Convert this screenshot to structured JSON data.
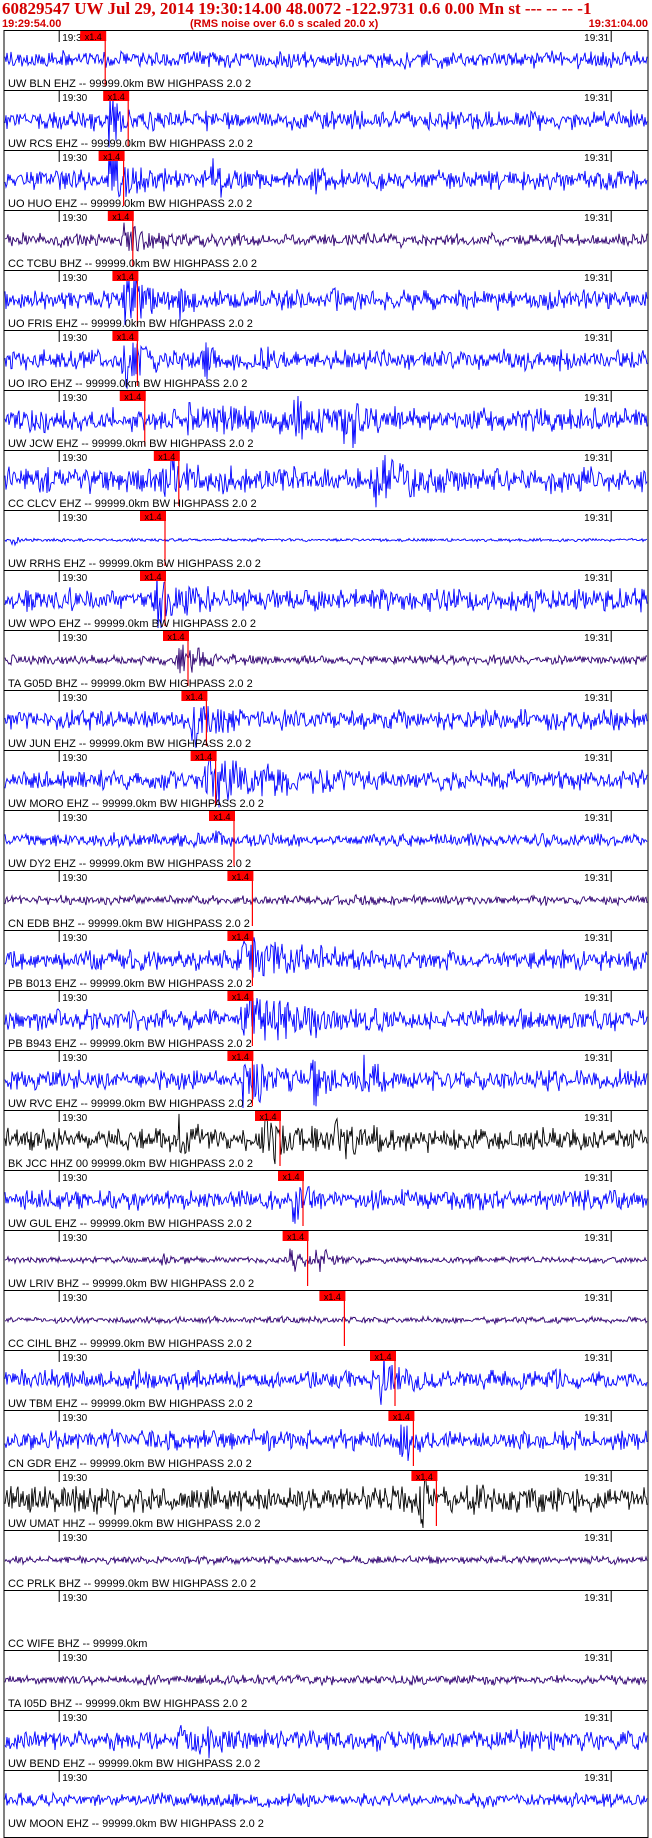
{
  "header": {
    "title": "60829547 UW Jul 29, 2014 19:30:14.00   48.0072 -122.9731  0.6 0.00 Mn st --- -- --   -1",
    "start_time": "19:29:54.00",
    "note": "(RMS noise over 6.0 s scaled 20.0 x)",
    "end_time": "19:31:04.00"
  },
  "chart_data": {
    "type": "line",
    "title": "60829547 UW Jul 29, 2014 19:30:14.00   48.0072 -122.9731  0.6 0.00 Mn st --- -- --   -1",
    "x_range": [
      "19:29:54.00",
      "19:31:04.00"
    ],
    "minute_tick_labels": [
      "19:30",
      "19:31"
    ],
    "pick_label": "x1.4",
    "pick_color": "#ff0000",
    "rows": [
      {
        "label": "UW BLN EHZ -- 99999.0km BW  HIGHPASS  2.0  2",
        "color": "#0000ff",
        "pick_s": 8.5,
        "amp": 0.25,
        "events": []
      },
      {
        "label": "UW RCS EHZ -- 99999.0km BW  HIGHPASS  2.0  2",
        "color": "#0000ff",
        "pick_s": 11.0,
        "amp": 0.3,
        "events": [
          [
            11.5,
            0.9,
            1.5
          ]
        ]
      },
      {
        "label": "UO HUO EHZ -- 99999.0km BW  HIGHPASS  2.0  2",
        "color": "#0000ff",
        "pick_s": 10.5,
        "amp": 0.3,
        "events": [
          [
            11.5,
            1.0,
            3
          ],
          [
            22.5,
            0.8,
            1.5
          ],
          [
            34,
            0.6,
            0.8
          ]
        ]
      },
      {
        "label": "CC TCBU BHZ -- 99999.0km BW  HIGHPASS  2.0  2",
        "color": "#2e0070",
        "pick_s": 11.5,
        "amp": 0.2,
        "events": [
          [
            13,
            0.6,
            4
          ]
        ]
      },
      {
        "label": "UO FRIS EHZ -- 99999.0km BW  HIGHPASS  2.0  2",
        "color": "#0000ff",
        "pick_s": 12.0,
        "amp": 0.3,
        "events": [
          [
            13,
            1.0,
            3
          ],
          [
            19,
            0.7,
            1
          ],
          [
            35.5,
            0.9,
            0.8
          ]
        ]
      },
      {
        "label": "UO IRO EHZ -- 99999.0km BW  HIGHPASS  2.0  2",
        "color": "#0000ff",
        "pick_s": 12.0,
        "amp": 0.3,
        "events": [
          [
            13,
            1.0,
            3
          ],
          [
            22,
            0.8,
            1.5
          ],
          [
            28,
            0.5,
            0.6
          ]
        ]
      },
      {
        "label": "UW JCW EHZ -- 99999.0km BW  HIGHPASS  2.0  2",
        "color": "#0000ff",
        "pick_s": 12.8,
        "amp": 0.35,
        "events": [
          [
            20,
            0.5,
            8
          ],
          [
            31.5,
            0.8,
            2
          ],
          [
            37,
            0.9,
            3
          ]
        ]
      },
      {
        "label": "CC CLCV EHZ -- 99999.0km BW  HIGHPASS  2.0  2",
        "color": "#0000ff",
        "pick_s": 16.5,
        "amp": 0.4,
        "events": [
          [
            17.5,
            0.8,
            3
          ],
          [
            40,
            1.0,
            4
          ]
        ]
      },
      {
        "label": "UW RRHS EHZ -- 99999.0km BW  HIGHPASS  2.0  2",
        "color": "#0000ff",
        "pick_s": 15.0,
        "amp": 0.05,
        "events": [
          [
            1,
            0.4,
            0.5
          ]
        ]
      },
      {
        "label": "UW WPO EHZ -- 99999.0km BW  HIGHPASS  2.0  2",
        "color": "#0000ff",
        "pick_s": 15.0,
        "amp": 0.35,
        "events": [
          [
            16.5,
            1.0,
            4
          ]
        ]
      },
      {
        "label": "TA G05D BHZ -- 99999.0km BW  HIGHPASS  2.0  2",
        "color": "#2e0070",
        "pick_s": 17.5,
        "amp": 0.15,
        "events": [
          [
            19,
            0.5,
            4
          ]
        ]
      },
      {
        "label": "UW JUN EHZ -- 99999.0km BW  HIGHPASS  2.0  2",
        "color": "#0000ff",
        "pick_s": 19.5,
        "amp": 0.3,
        "events": [
          [
            20.5,
            1.0,
            3
          ]
        ]
      },
      {
        "label": "UW MORO EHZ -- 99999.0km BW  HIGHPASS  2.0  2",
        "color": "#0000ff",
        "pick_s": 20.5,
        "amp": 0.3,
        "events": [
          [
            22,
            0.9,
            8
          ]
        ]
      },
      {
        "label": "UW DY2 EHZ -- 99999.0km BW  HIGHPASS  2.0  2",
        "color": "#0000ff",
        "pick_s": 22.5,
        "amp": 0.2,
        "events": [
          [
            12,
            0.4,
            0.5
          ],
          [
            23,
            0.5,
            0.8
          ],
          [
            43,
            0.3,
            0.5
          ]
        ]
      },
      {
        "label": "CN EDB BHZ -- 99999.0km BW  HIGHPASS  2.0  2",
        "color": "#2e0070",
        "pick_s": 24.5,
        "amp": 0.15,
        "events": []
      },
      {
        "label": "PB B013 EHZ -- 99999.0km BW  HIGHPASS  2.0  2",
        "color": "#0000ff",
        "pick_s": 24.5,
        "amp": 0.3,
        "events": [
          [
            26,
            0.9,
            8
          ]
        ]
      },
      {
        "label": "PB B943 EHZ -- 99999.0km BW  HIGHPASS  2.0  2",
        "color": "#0000ff",
        "pick_s": 24.5,
        "amp": 0.3,
        "events": [
          [
            26,
            0.9,
            8
          ]
        ]
      },
      {
        "label": "UW RVC EHZ -- 99999.0km BW  HIGHPASS  2.0  2",
        "color": "#0000ff",
        "pick_s": 24.5,
        "amp": 0.3,
        "events": [
          [
            26,
            0.8,
            6
          ],
          [
            33.5,
            0.9,
            2.5
          ],
          [
            39,
            0.8,
            2
          ]
        ]
      },
      {
        "label": "BK JCC HHZ 00 99999.0km BW  HIGHPASS  2.0  2",
        "color": "#000000",
        "pick_s": 27.5,
        "amp": 0.35,
        "events": [
          [
            19,
            0.6,
            2
          ],
          [
            28,
            1.0,
            3
          ],
          [
            36,
            0.8,
            4
          ]
        ]
      },
      {
        "label": "UW GUL EHZ -- 99999.0km BW  HIGHPASS  2.0  2",
        "color": "#0000ff",
        "pick_s": 30.0,
        "amp": 0.3,
        "events": [
          [
            31.5,
            0.9,
            2
          ]
        ]
      },
      {
        "label": "UW LRIV BHZ -- 99999.0km BW  HIGHPASS  2.0  2",
        "color": "#2e0070",
        "pick_s": 30.5,
        "amp": 0.1,
        "events": [
          [
            17,
            0.3,
            2
          ],
          [
            31,
            0.5,
            2
          ],
          [
            34,
            0.4,
            3
          ]
        ]
      },
      {
        "label": "CC CIHL BHZ -- 99999.0km BW  HIGHPASS  2.0  2",
        "color": "#2e0070",
        "pick_s": 34.5,
        "amp": 0.1,
        "events": []
      },
      {
        "label": "UW TBM EHZ -- 99999.0km BW  HIGHPASS  2.0  2",
        "color": "#0000ff",
        "pick_s": 40.0,
        "amp": 0.3,
        "events": [
          [
            41,
            1.0,
            2.5
          ]
        ]
      },
      {
        "label": "CN GDR EHZ -- 99999.0km BW  HIGHPASS  2.0  2",
        "color": "#0000ff",
        "pick_s": 42.0,
        "amp": 0.3,
        "events": [
          [
            43,
            1.0,
            2
          ]
        ]
      },
      {
        "label": "UW UMAT HHZ -- 99999.0km BW  HIGHPASS  2.0  2",
        "color": "#000000",
        "pick_s": 44.5,
        "amp": 0.4,
        "events": [
          [
            45.5,
            1.0,
            0.8
          ]
        ]
      },
      {
        "label": "CC PRLK BHZ -- 99999.0km BW  HIGHPASS  2.0  2",
        "color": "#2e0070",
        "pick_s": null,
        "amp": 0.12,
        "events": []
      },
      {
        "label": "CC WIFE BHZ -- 99999.0km",
        "color": "#2e0070",
        "pick_s": null,
        "amp": 0.0,
        "events": []
      },
      {
        "label": "TA I05D BHZ -- 99999.0km BW  HIGHPASS  2.0  2",
        "color": "#2e0070",
        "pick_s": null,
        "amp": 0.15,
        "events": []
      },
      {
        "label": "UW BEND EHZ -- 99999.0km BW  HIGHPASS  2.0  2",
        "color": "#0000ff",
        "pick_s": null,
        "amp": 0.3,
        "events": [
          [
            19,
            0.5,
            6
          ]
        ]
      },
      {
        "label": "UW MOON EHZ -- 99999.0km BW  HIGHPASS  2.0  2",
        "color": "#0000ff",
        "pick_s": null,
        "amp": 0.2,
        "events": []
      }
    ]
  }
}
